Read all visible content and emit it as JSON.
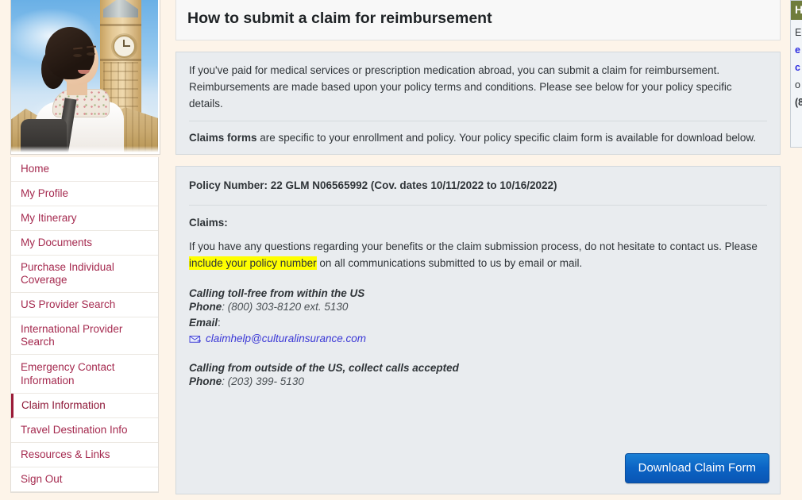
{
  "sidebar": {
    "photo_alt": "student-traveler-photo",
    "items": [
      {
        "label": "Home",
        "active": false
      },
      {
        "label": "My Profile",
        "active": false
      },
      {
        "label": "My Itinerary",
        "active": false
      },
      {
        "label": "My Documents",
        "active": false
      },
      {
        "label": "Purchase Individual Coverage",
        "active": false
      },
      {
        "label": "US Provider Search",
        "active": false
      },
      {
        "label": "International Provider Search",
        "active": false
      },
      {
        "label": "Emergency Contact Information",
        "active": false
      },
      {
        "label": "Claim Information",
        "active": true
      },
      {
        "label": "Travel Destination Info",
        "active": false
      },
      {
        "label": "Resources & Links",
        "active": false
      },
      {
        "label": "Sign Out",
        "active": false
      }
    ]
  },
  "main": {
    "page_title": "How to submit a claim for reimbursement",
    "intro_paragraph_1": "If you've paid for medical services or prescription medication abroad, you can submit a claim for reimbursement. Reimbursements are made based upon your policy terms and conditions. Please see below for your policy specific details.",
    "intro_paragraph_2_bold": "Claims forms",
    "intro_paragraph_2_rest": " are specific to your enrollment and policy. Your policy specific claim form is available for download below.",
    "policy_line": "Policy Number: 22 GLM N06565992 (Cov. dates 10/11/2022 to 10/16/2022)",
    "claims_label": "Claims:",
    "contact_text_before": "If you have any questions regarding your benefits or the claim submission process, do not hesitate to contact us. Please ",
    "contact_text_highlight": "include your policy number",
    "contact_text_after": " on all communications submitted to us by email or mail.",
    "us_heading": "Calling toll-free from within the US",
    "us_phone_label": "Phone",
    "us_phone_value": ": (800) 303-8120 ext. 5130",
    "email_label": "Email",
    "email_label_colon": ":",
    "email_address": "claimhelp@culturalinsurance.com",
    "outside_heading": "Calling from outside of the US, collect calls accepted",
    "outside_phone_label": "Phone",
    "outside_phone_value": ": (203) 399- 5130",
    "download_button": "Download Claim Form"
  },
  "right_panel": {
    "header": "H",
    "lines": [
      "E",
      "e",
      "c",
      "o",
      "(8"
    ]
  },
  "colors": {
    "accent_link": "#a52a4f",
    "active_nav": "#9b1b38",
    "highlight": "#ffff00",
    "email_link": "#3b38d6",
    "button_blue": "#0b63c4",
    "panel_bg": "#e9ecef",
    "page_bg": "#fdf4e9",
    "right_header_green": "#6f7c3c"
  }
}
